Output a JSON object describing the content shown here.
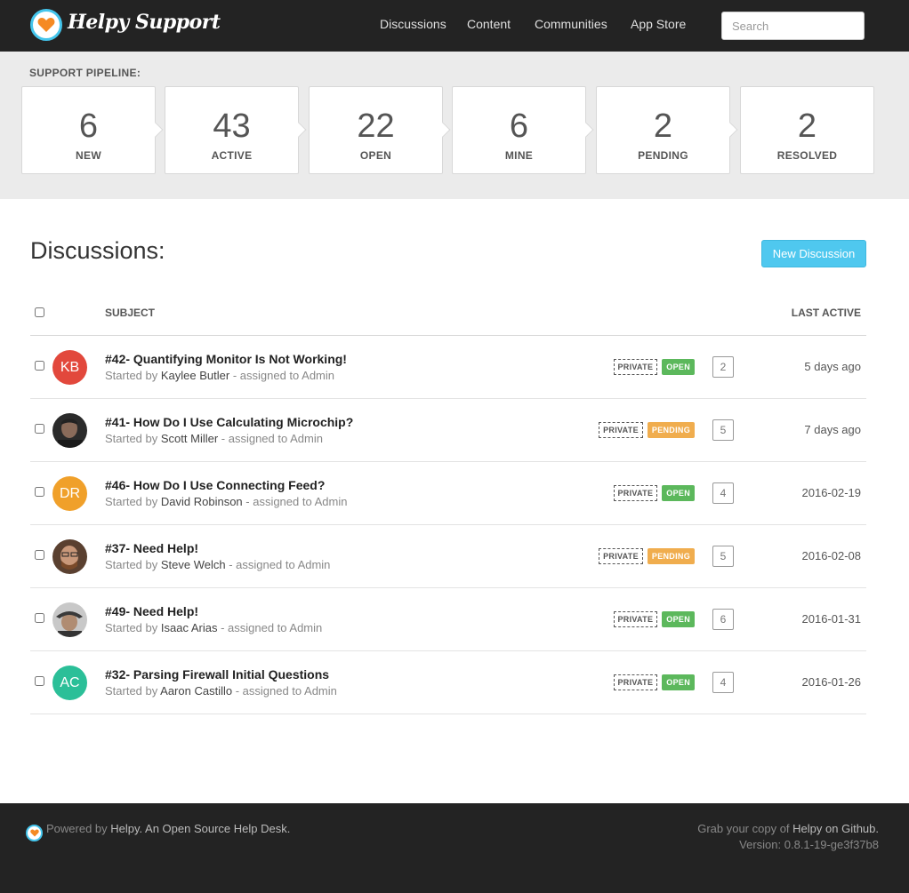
{
  "header": {
    "brand": "Helpy Support",
    "nav": [
      "Discussions",
      "Content",
      "Communities",
      "App Store"
    ],
    "search_placeholder": "Search"
  },
  "pipeline": {
    "label": "SUPPORT PIPELINE:",
    "stages": [
      {
        "count": "6",
        "name": "NEW"
      },
      {
        "count": "43",
        "name": "ACTIVE"
      },
      {
        "count": "22",
        "name": "OPEN"
      },
      {
        "count": "6",
        "name": "MINE"
      },
      {
        "count": "2",
        "name": "PENDING"
      },
      {
        "count": "2",
        "name": "RESOLVED"
      }
    ]
  },
  "main": {
    "title": "Discussions:",
    "new_button": "New Discussion",
    "columns": {
      "subject": "SUBJECT",
      "last_active": "LAST ACTIVE"
    },
    "rows": [
      {
        "subject": "#42- Quantifying Monitor Is Not Working!",
        "started_prefix": "Started by ",
        "author": "Kaylee Butler",
        "assigned": " - assigned to Admin",
        "privacy": "PRIVATE",
        "status": "OPEN",
        "replies": "2",
        "last_active": "5 days ago",
        "initials": "KB",
        "avatar_color": "#e2483c"
      },
      {
        "subject": "#41- How Do I Use Calculating Microchip?",
        "started_prefix": "Started by ",
        "author": "Scott Miller",
        "assigned": " - assigned to Admin",
        "privacy": "PRIVATE",
        "status": "PENDING",
        "replies": "5",
        "last_active": "7 days ago",
        "initials": "",
        "avatar_color": "#3a3a3a"
      },
      {
        "subject": "#46- How Do I Use Connecting Feed?",
        "started_prefix": "Started by ",
        "author": "David Robinson",
        "assigned": " - assigned to Admin",
        "privacy": "PRIVATE",
        "status": "OPEN",
        "replies": "4",
        "last_active": "2016-02-19",
        "initials": "DR",
        "avatar_color": "#f0a02a"
      },
      {
        "subject": "#37- Need Help!",
        "started_prefix": "Started by ",
        "author": "Steve Welch",
        "assigned": " - assigned to Admin",
        "privacy": "PRIVATE",
        "status": "PENDING",
        "replies": "5",
        "last_active": "2016-02-08",
        "initials": "",
        "avatar_color": "#7a5a45"
      },
      {
        "subject": "#49- Need Help!",
        "started_prefix": "Started by ",
        "author": "Isaac Arias",
        "assigned": " - assigned to Admin",
        "privacy": "PRIVATE",
        "status": "OPEN",
        "replies": "6",
        "last_active": "2016-01-31",
        "initials": "",
        "avatar_color": "#6a6a6a"
      },
      {
        "subject": "#32- Parsing Firewall Initial Questions",
        "started_prefix": "Started by ",
        "author": "Aaron Castillo",
        "assigned": " - assigned to Admin",
        "privacy": "PRIVATE",
        "status": "OPEN",
        "replies": "4",
        "last_active": "2016-01-26",
        "initials": "AC",
        "avatar_color": "#2bbf98"
      }
    ]
  },
  "footer": {
    "powered_prefix": "Powered by ",
    "powered_link": "Helpy. An Open Source Help Desk.",
    "grab_prefix": "Grab your copy of ",
    "grab_link": "Helpy on Github.",
    "version": "Version: 0.8.1-19-ge3f37b8"
  },
  "colors": {
    "accent": "#4fc8ef",
    "open": "#5cb85c",
    "pending": "#f0ad4e",
    "header_bg": "#232323"
  }
}
